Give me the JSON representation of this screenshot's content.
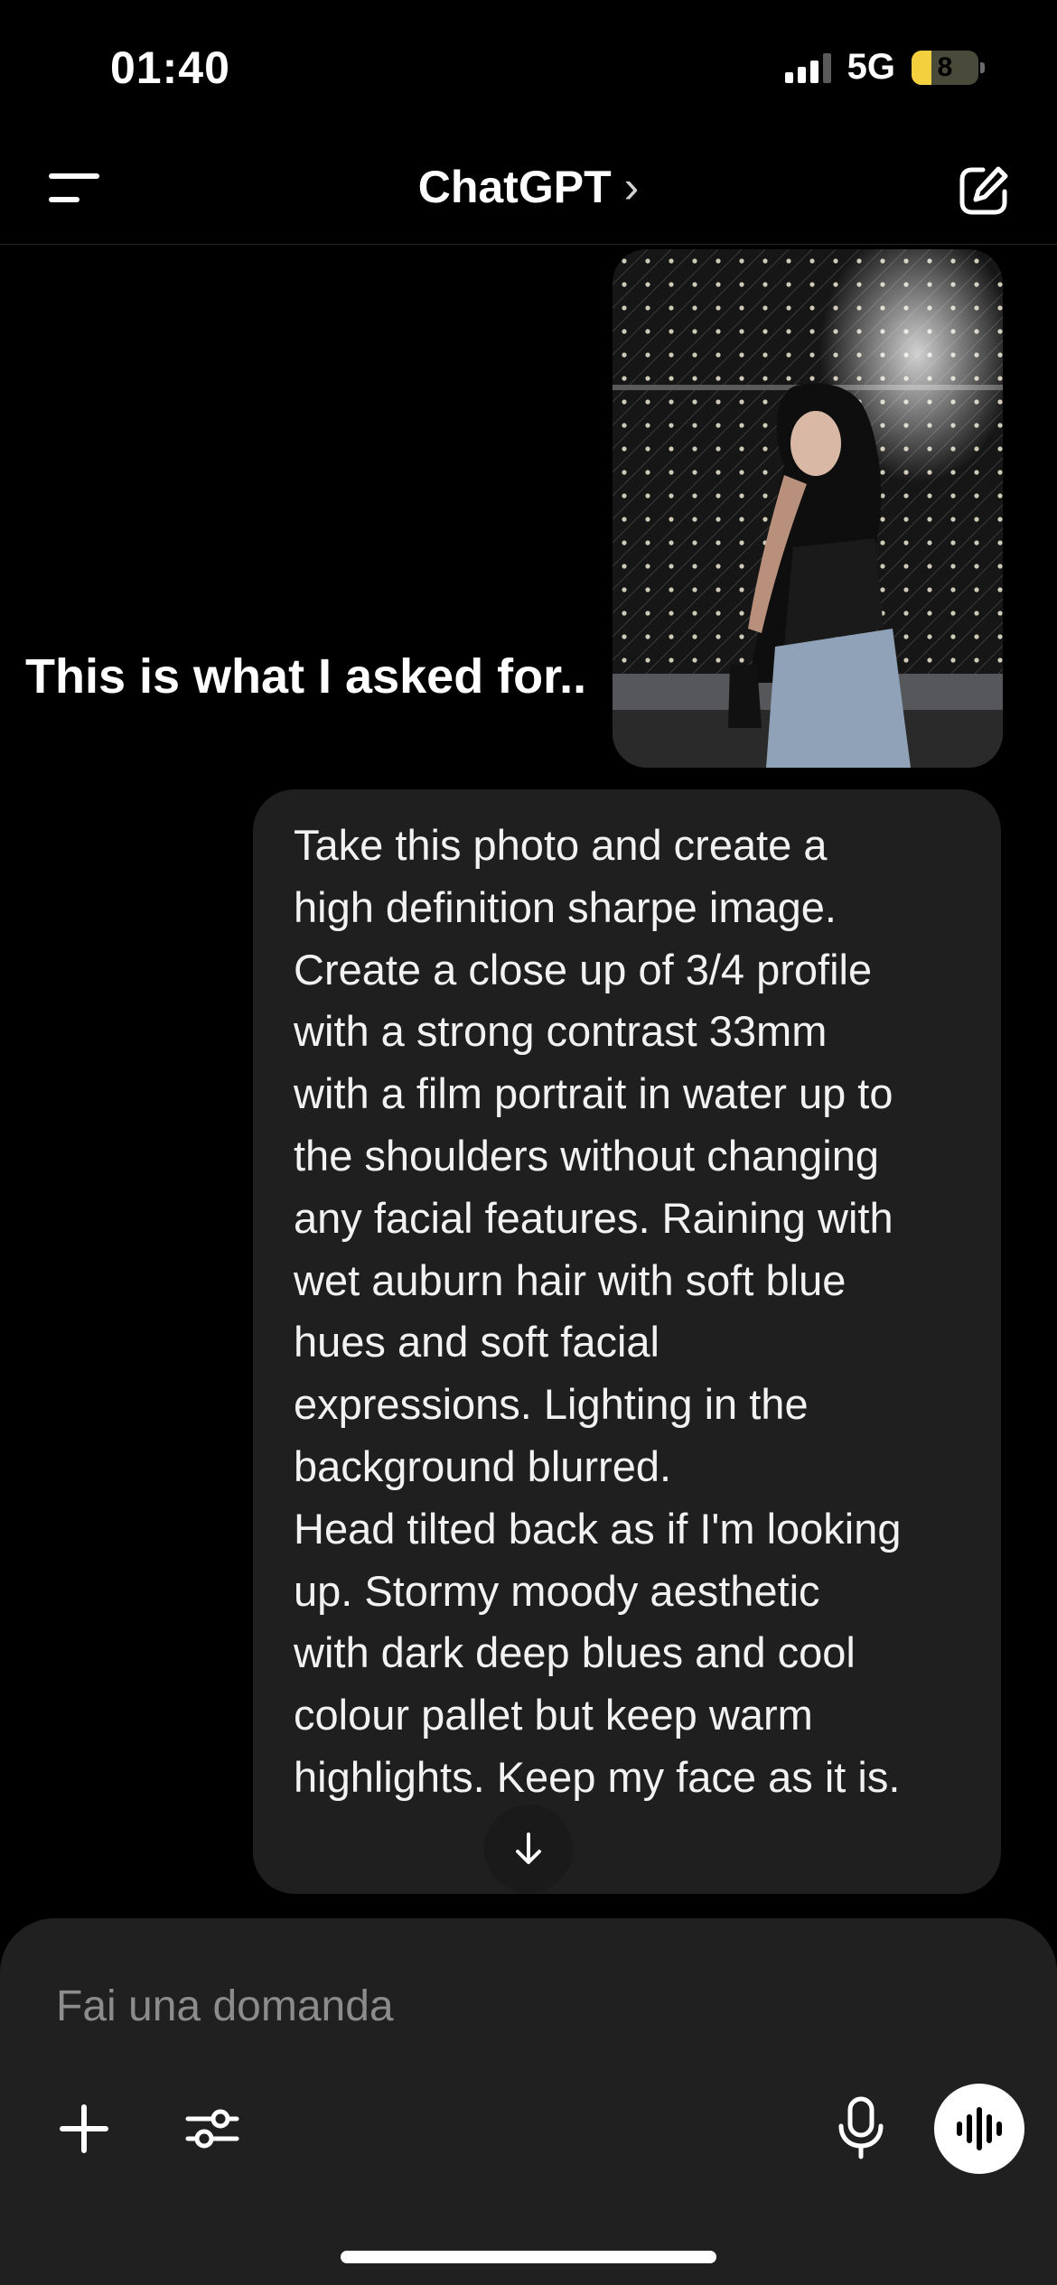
{
  "status_bar": {
    "time": "01:40",
    "network": "5G",
    "battery": "8",
    "battery_level": 0.08
  },
  "header": {
    "title": "ChatGPT",
    "title_chevron": "›",
    "icons": {
      "menu": "menu-icon",
      "new_chat": "new-chat-icon"
    }
  },
  "chat": {
    "user_image_caption": "This is what I asked for..",
    "user_prompt": "Take this photo and create a\nhigh definition sharpe image.\nCreate a close up of 3/4 profile\nwith a strong contrast 33mm\nwith a film portrait in water up to\nthe shoulders without changing\nany facial features. Raining with\nwet auburn hair with soft blue\nhues and soft facial\nexpressions. Lighting in the\nbackground blurred.\nHead tilted back as if I'm looking\nup. Stormy moody aesthetic\nwith dark deep blues and cool\ncolour pallet but keep warm\nhighlights. Keep my face as it is."
  },
  "composer": {
    "placeholder": "Fai una domanda",
    "icons": {
      "attach": "plus-icon",
      "tools": "sliders-icon",
      "dictate": "microphone-icon",
      "voice": "voice-waveform-icon",
      "scroll": "arrow-down-icon"
    }
  },
  "colors": {
    "background": "#000000",
    "bubble": "#1f1f1f",
    "composer": "#202020",
    "battery_accent": "#f4d03f"
  }
}
